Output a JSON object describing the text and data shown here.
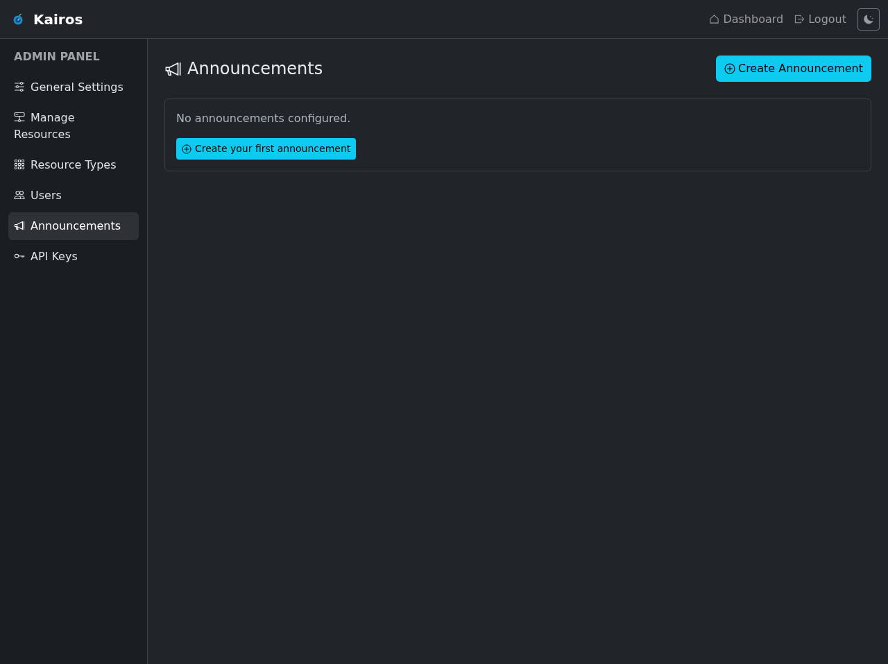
{
  "navbar": {
    "brand": "Kairos",
    "links": [
      "Dashboard",
      "Logout"
    ]
  },
  "sidebar": {
    "heading": "ADMIN PANEL",
    "items": [
      {
        "label": "General Settings",
        "selected": false
      },
      {
        "label": "Manage Resources",
        "selected": false
      },
      {
        "label": "Resource Types",
        "selected": false
      },
      {
        "label": "Users",
        "selected": false
      },
      {
        "label": "Announcements",
        "selected": true
      },
      {
        "label": "API Keys",
        "selected": false
      }
    ]
  },
  "main": {
    "title": "Announcements",
    "create_button": "Create Announcement",
    "empty_state": {
      "message": "No announcements configured.",
      "button": "Create your first announcement"
    }
  }
}
